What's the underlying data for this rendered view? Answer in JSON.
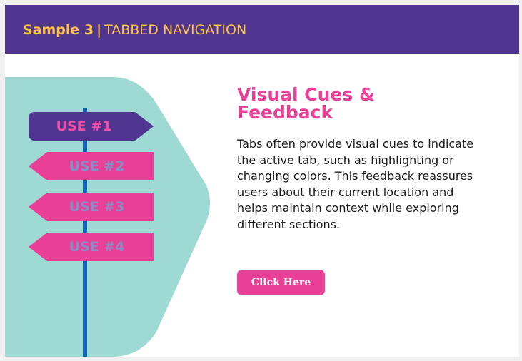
{
  "header": {
    "sample_label": "Sample 3",
    "separator": "|",
    "subtitle": "TABBED NAVIGATION"
  },
  "tabs": [
    {
      "label": "USE #1",
      "active": true
    },
    {
      "label": "USE #2",
      "active": false
    },
    {
      "label": "USE #3",
      "active": false
    },
    {
      "label": "USE #4",
      "active": false
    }
  ],
  "content": {
    "title": "Visual Cues & Feedback",
    "body": "Tabs often provide visual cues to indicate the active tab, such as highlighting or changing colors. This feedback reassures users about their current location and helps maintain context while exploring different sections.",
    "button_label": "Click Here"
  },
  "colors": {
    "header_bg": "#4f3490",
    "header_text": "#ffc046",
    "panel": "#9ed9d4",
    "pole": "#1466b4",
    "tab_active_bg": "#4f3490",
    "tab_inactive_bg": "#ea3f96",
    "tab_text": "#8a8cc6",
    "accent": "#ea3f96"
  },
  "icons": {
    "signpost": "signpost-pole-icon"
  }
}
